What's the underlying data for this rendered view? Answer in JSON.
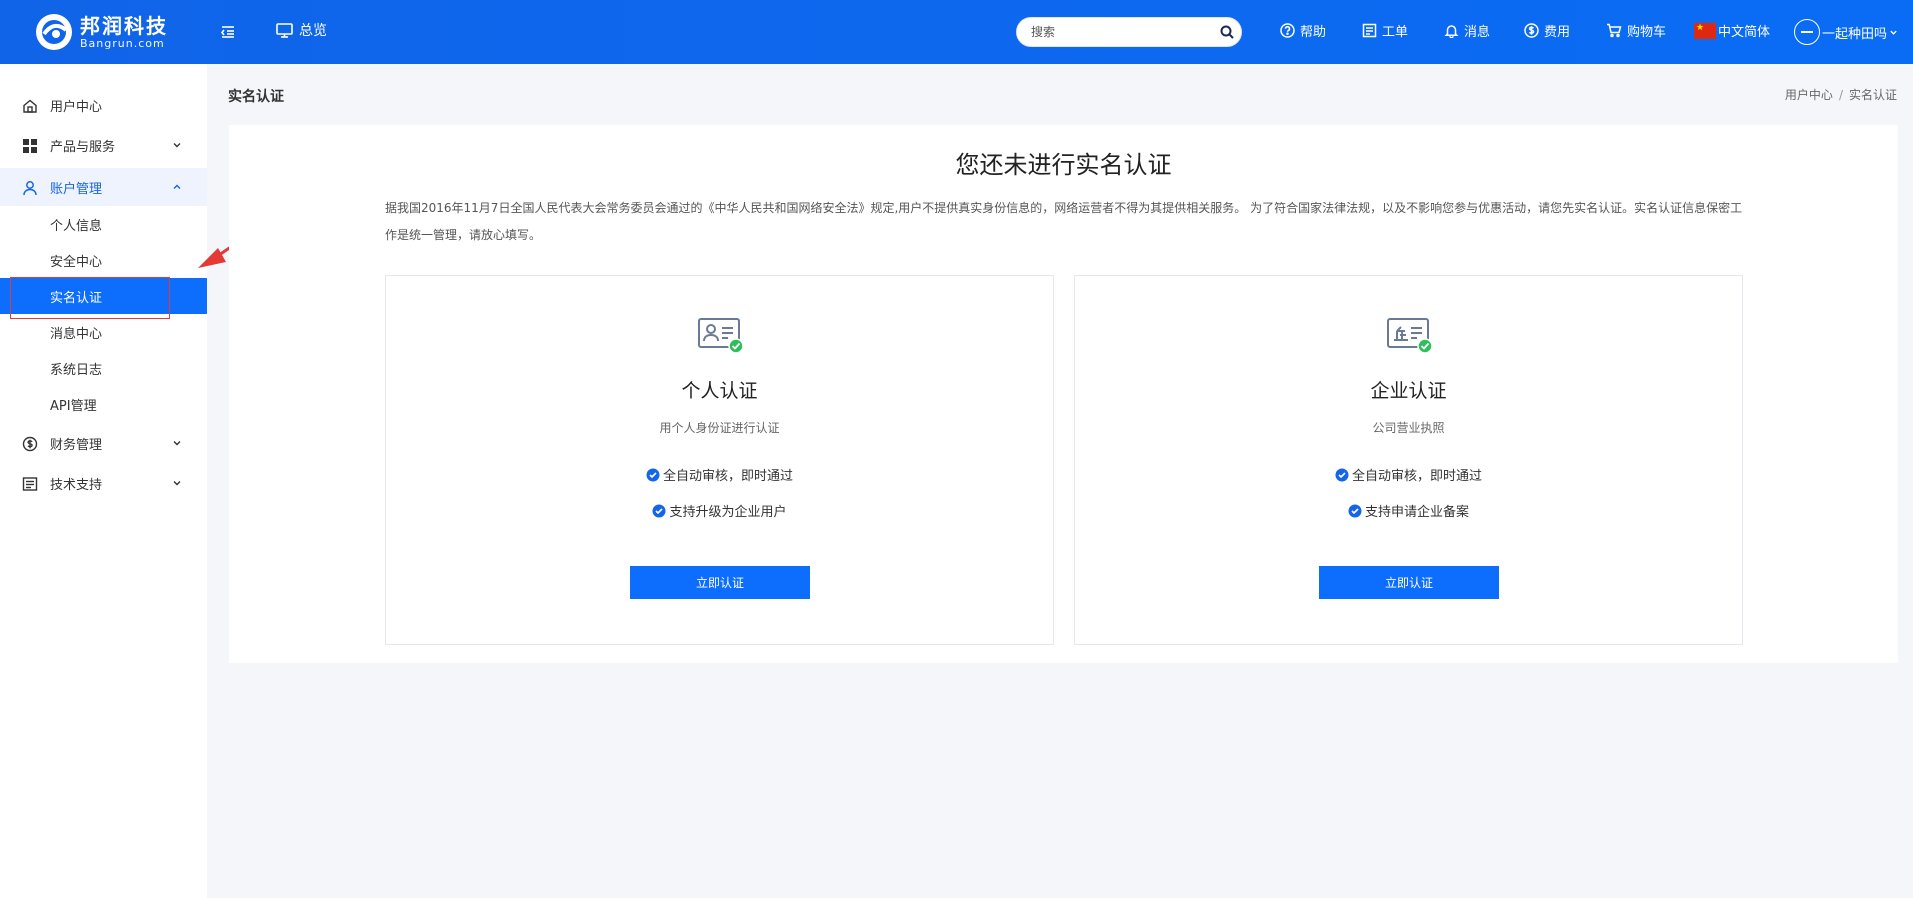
{
  "header": {
    "logo_cn": "邦润科技",
    "logo_en": "Bangrun.com",
    "overview_label": "总览",
    "search_placeholder": "搜索",
    "nav": {
      "help": "帮助",
      "ticket": "工单",
      "message": "消息",
      "cost": "费用",
      "cart": "购物车",
      "language": "中文简体",
      "user": "一起种田吗"
    }
  },
  "sidebar": {
    "items": [
      {
        "label": "用户中心",
        "icon": "home-icon"
      },
      {
        "label": "产品与服务",
        "icon": "grid-icon"
      },
      {
        "label": "账户管理",
        "icon": "user-icon"
      },
      {
        "label": "财务管理",
        "icon": "dollar-icon"
      },
      {
        "label": "技术支持",
        "icon": "list-icon"
      }
    ],
    "account_sub": [
      "个人信息",
      "安全中心",
      "实名认证",
      "消息中心",
      "系统日志",
      "API管理"
    ],
    "active_sub": "实名认证"
  },
  "page": {
    "title": "实名认证",
    "breadcrumb": [
      "用户中心",
      "实名认证"
    ],
    "breadcrumb_sep": "/"
  },
  "panel": {
    "title": "您还未进行实名认证",
    "notice": "据我国2016年11月7日全国人民代表大会常务委员会通过的《中华人民共和国网络安全法》规定,用户不提供真实身份信息的，网络运营者不得为其提供相关服务。 为了符合国家法律法规，以及不影响您参与优惠活动，请您先实名认证。实名认证信息保密工作是统一管理，请放心填写。",
    "cards": [
      {
        "title": "个人认证",
        "subtitle": "用个人身份证进行认证",
        "features": [
          "全自动审核，即时通过",
          "支持升级为企业用户"
        ],
        "button": "立即认证",
        "icon": "id-card-icon"
      },
      {
        "title": "企业认证",
        "subtitle": "公司营业执照",
        "features": [
          "全自动审核，即时通过",
          "支持申请企业备案"
        ],
        "button": "立即认证",
        "icon": "business-license-icon"
      }
    ]
  },
  "colors": {
    "brand": "#0d6efd",
    "header": "#1064e8",
    "check_green": "#2fbf5a",
    "annotation_red": "#e53935"
  }
}
